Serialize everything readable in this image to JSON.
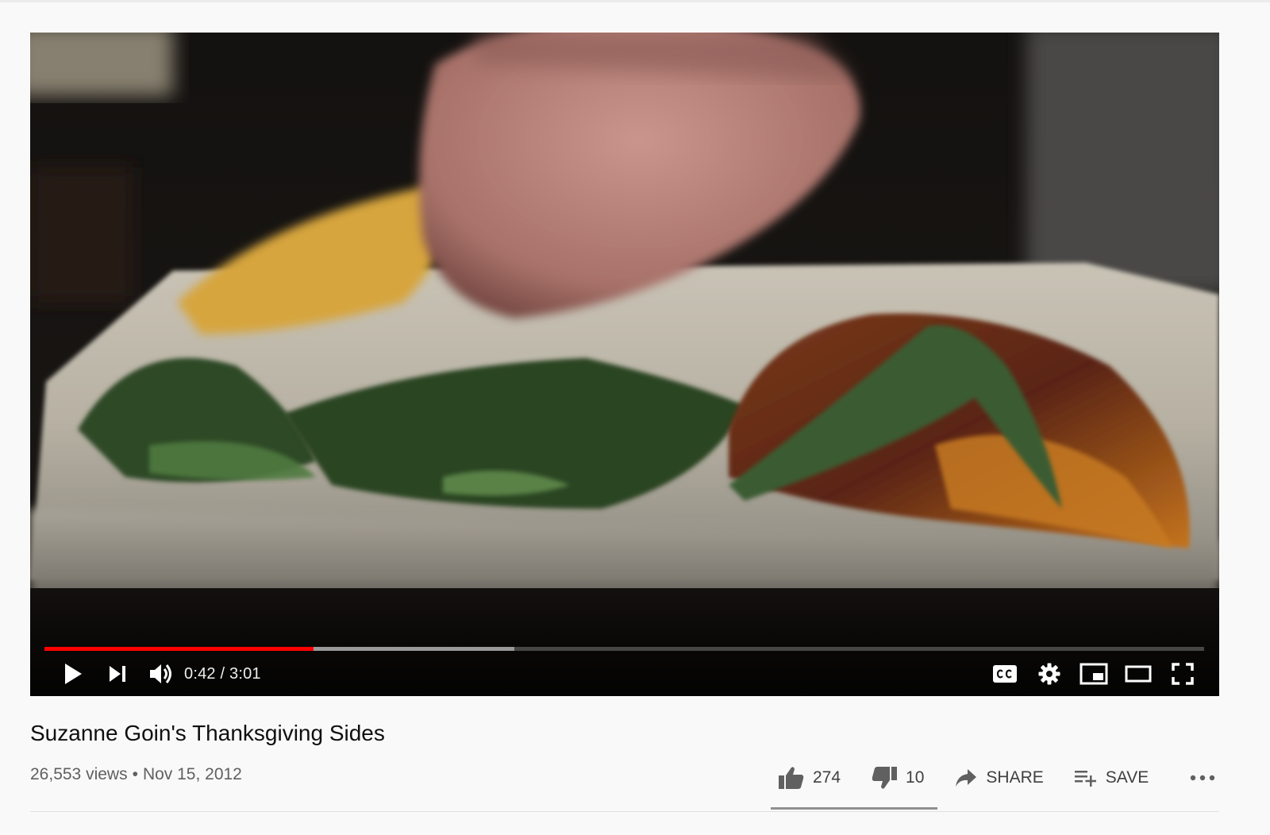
{
  "player": {
    "time_current": "0:42",
    "time_total": "3:01",
    "time_separator": " / ",
    "progress_played_fraction": 0.232,
    "progress_buffered_fraction": 0.405,
    "accent_color": "#ff0000",
    "controls": {
      "play": "play-icon",
      "next": "next-icon",
      "volume": "volume-icon",
      "captions": "captions-icon",
      "settings": "gear-icon",
      "miniplayer": "miniplayer-icon",
      "theater": "theater-icon",
      "fullscreen": "fullscreen-icon"
    }
  },
  "video": {
    "title": "Suzanne Goin's Thanksgiving Sides",
    "views": "26,553 views",
    "date": "Nov 15, 2012"
  },
  "actions": {
    "likes": "274",
    "dislikes": "10",
    "share_label": "SHARE",
    "save_label": "SAVE"
  }
}
